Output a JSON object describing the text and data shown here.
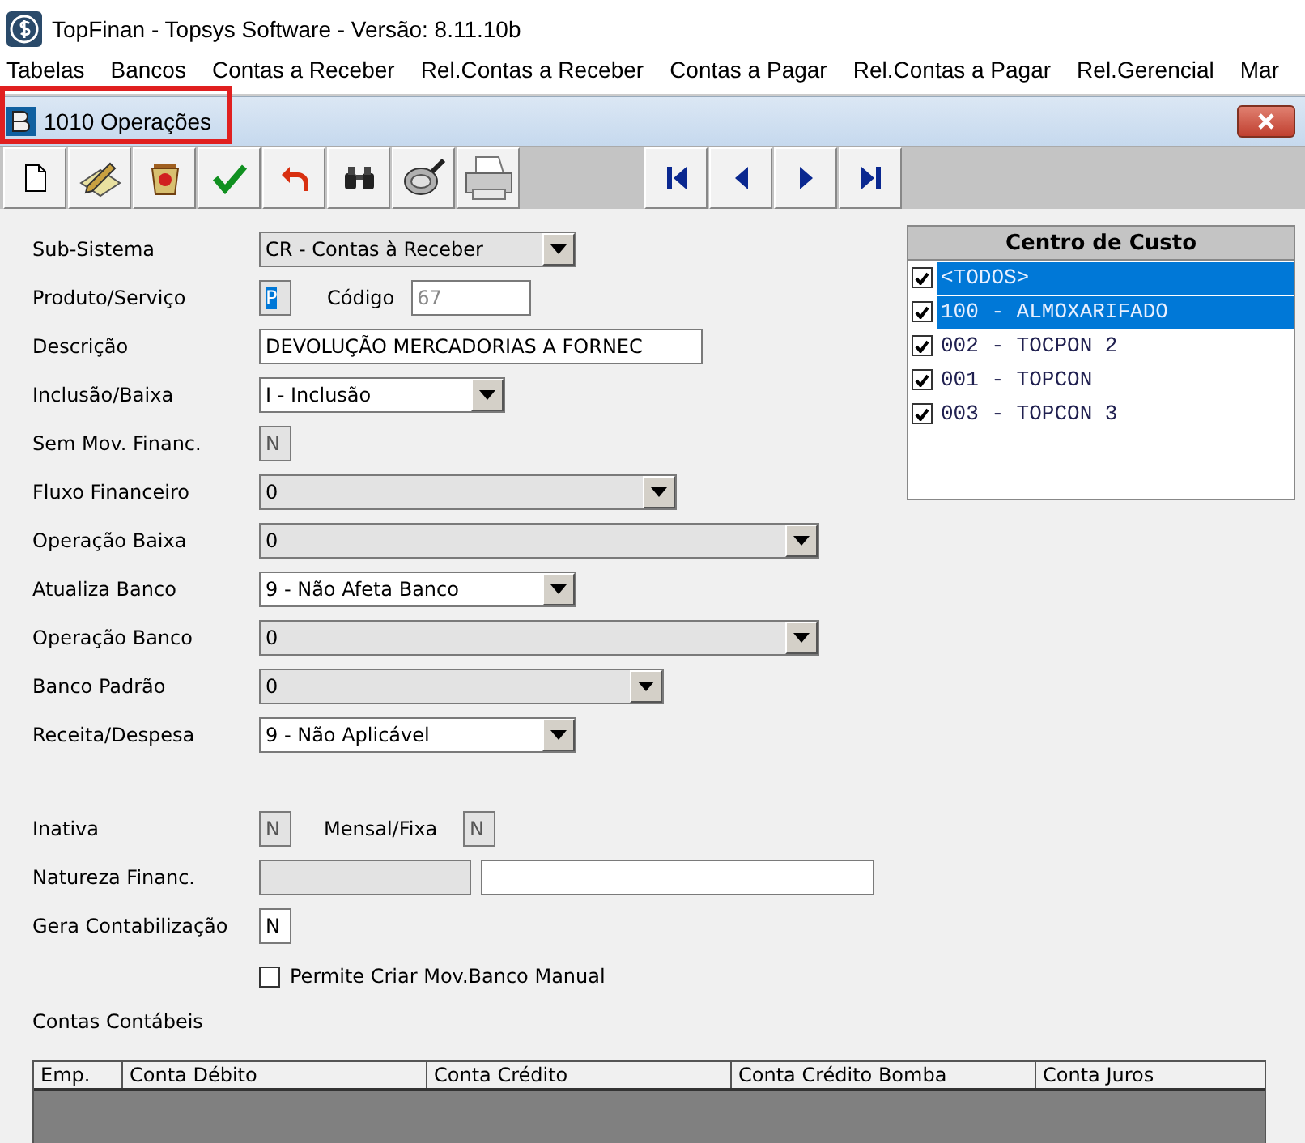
{
  "app": {
    "title": "TopFinan - Topsys Software - Versão: 8.11.10b"
  },
  "menu": [
    "Tabelas",
    "Bancos",
    "Contas a Receber",
    "Rel.Contas a Receber",
    "Contas a Pagar",
    "Rel.Contas a Pagar",
    "Rel.Gerencial",
    "Mar"
  ],
  "window": {
    "title": "1010 Operações",
    "highlighted": true
  },
  "toolbar": [
    {
      "kind": "new"
    },
    {
      "kind": "edit"
    },
    {
      "kind": "delete"
    },
    {
      "kind": "confirm"
    },
    {
      "kind": "undo"
    },
    {
      "kind": "find"
    },
    {
      "kind": "lens"
    },
    {
      "kind": "print"
    }
  ],
  "navigation": [
    {
      "kind": "first"
    },
    {
      "kind": "prev"
    },
    {
      "kind": "next"
    },
    {
      "kind": "last"
    }
  ],
  "fields": [
    {
      "kind": "combo",
      "label": "Sub-Sistema",
      "value": "CR - Contas à Receber",
      "disabled": true
    },
    {
      "kind": "code",
      "label": "Produto/Serviço",
      "value": "P",
      "selected": true,
      "code_label": "Código",
      "code": "67",
      "code_disabled": true
    },
    {
      "kind": "text",
      "label": "Descrição",
      "value": "DEVOLUÇÃO MERCADORIAS A FORNEC"
    },
    {
      "kind": "combo",
      "label": "Inclusão/Baixa",
      "value": "I - Inclusão",
      "disabled": false
    },
    {
      "kind": "flag",
      "label": "Sem Mov. Financ.",
      "value": "N",
      "disabled": true
    },
    {
      "kind": "combo",
      "label": "Fluxo Financeiro",
      "value": "0",
      "disabled": true
    },
    {
      "kind": "combo",
      "label": "Operação Baixa",
      "value": "0",
      "disabled": true
    },
    {
      "kind": "combo",
      "label": "Atualiza Banco",
      "value": "9 - Não Afeta Banco",
      "disabled": false
    },
    {
      "kind": "combo",
      "label": "Operação Banco",
      "value": "0",
      "disabled": true
    },
    {
      "kind": "combo",
      "label": "Banco Padrão",
      "value": "0",
      "disabled": true
    },
    {
      "kind": "combo",
      "label": "Receita/Despesa",
      "value": "9 - Não Aplicável",
      "disabled": false
    }
  ],
  "fields2": [
    {
      "kind": "flag_pair",
      "label": "Inativa",
      "value": "N",
      "disabled": true,
      "label2": "Mensal/Fixa",
      "value2": "N",
      "disabled2": true
    },
    {
      "kind": "lookup",
      "label": "Natureza Financ."
    },
    {
      "kind": "flag",
      "label": "Gera Contabilização",
      "value": "N",
      "disabled": false
    },
    {
      "kind": "checkbox",
      "label": "Permite Criar Mov.Banco Manual",
      "checked": false
    }
  ],
  "cost_centers": {
    "title": "Centro de Custo",
    "items": [
      {
        "label": "<TODOS>",
        "checked": true,
        "selected": true
      },
      {
        "label": "100 - ALMOXARIFADO",
        "checked": true,
        "selected": true
      },
      {
        "label": "002 - TOCPON 2",
        "checked": true,
        "selected": false
      },
      {
        "label": "001 - TOPCON",
        "checked": true,
        "selected": false
      },
      {
        "label": "003 - TOPCON 3",
        "checked": true,
        "selected": false
      }
    ]
  },
  "accounts": {
    "title": "Contas Contábeis",
    "columns": [
      "Emp.",
      "Conta Débito",
      "Conta Crédito",
      "Conta Crédito Bomba",
      "Conta Juros"
    ]
  }
}
